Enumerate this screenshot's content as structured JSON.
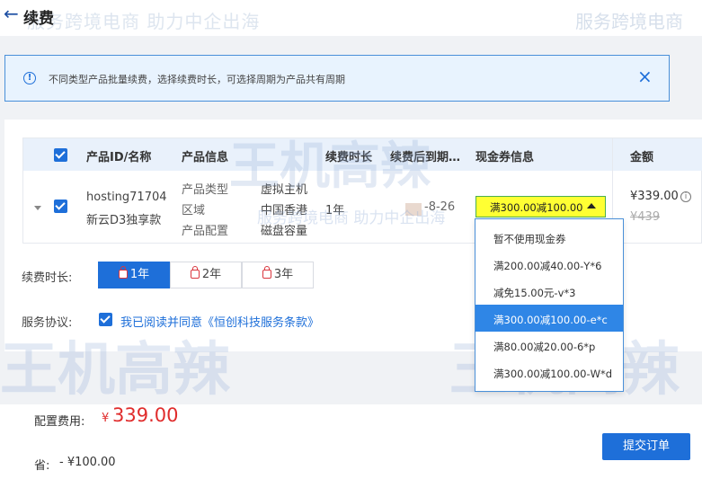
{
  "header": {
    "title": "续费",
    "back_icon": "arrow-left-icon"
  },
  "watermark": {
    "slogan": "服务跨境电商 助力中企出海",
    "slogan_right": "服务跨境电商",
    "logo_text": "王机高辣"
  },
  "notice": {
    "text": "不同类型产品批量续费，选择续费时长，可选择周期为产品共有周期",
    "close": "×"
  },
  "table": {
    "columns": [
      "产品ID/名称",
      "产品信息",
      "续费时长",
      "续费后到期…",
      "现金券信息",
      "金额"
    ],
    "row": {
      "product_id": "hosting71704",
      "product_name": "新云D3独享款",
      "info_labels": [
        "产品类型",
        "区域",
        "产品配置"
      ],
      "info_values": [
        "虚拟主机",
        "中国香港",
        "磁盘容量"
      ],
      "duration": "1年",
      "expiry_partial": "-8-26",
      "coupon_selected": "满300.00减100.00",
      "price": "¥339.00",
      "price_info": "i",
      "old_price": "¥439"
    }
  },
  "duration": {
    "label": "续费时长:",
    "options": [
      "1年",
      "2年",
      "3年"
    ],
    "selected_index": 0
  },
  "agreement": {
    "label": "服务协议:",
    "text": "我已阅读并同意《恒创科技服务条款》",
    "checked": true
  },
  "coupon_dropdown": {
    "items": [
      "暂不使用现金券",
      "满200.00减40.00-Y*6",
      "减免15.00元-v*3",
      "满300.00减100.00-e*c",
      "满80.00减20.00-6*p",
      "满300.00减100.00-W*d"
    ],
    "selected_index": 3
  },
  "footer": {
    "fee_label": "配置费用:",
    "fee_currency": "¥",
    "fee_amount": "339.00",
    "save_label": "省:",
    "save_amount": "- ¥100.00",
    "submit_label": "提交订单"
  },
  "colors": {
    "accent": "#1e6fd9",
    "coupon_highlight": "#ffff33",
    "price_red": "#e02c2c"
  }
}
